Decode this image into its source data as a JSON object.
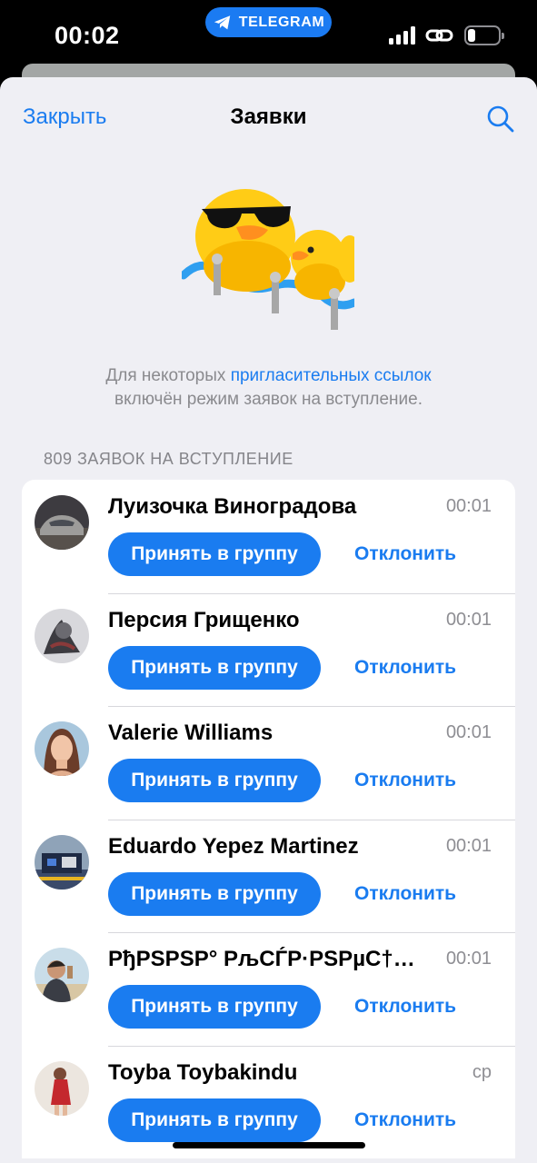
{
  "status_bar": {
    "time": "00:02",
    "pill_label": "TELEGRAM"
  },
  "nav": {
    "close_label": "Закрыть",
    "title": "Заявки"
  },
  "info": {
    "prefix": "Для некоторых ",
    "link": "пригласительных ссылок",
    "suffix": "включён режим заявок на вступление."
  },
  "section_header": "809 ЗАЯВОК НА ВСТУПЛЕНИЕ",
  "requests": [
    {
      "name": "Луизочка Виноградова",
      "time": "00:01",
      "accept_label": "Принять в группу",
      "decline_label": "Отклонить"
    },
    {
      "name": "Персия Грищенко",
      "time": "00:01",
      "accept_label": "Принять в группу",
      "decline_label": "Отклонить"
    },
    {
      "name": "Valerie Williams",
      "time": "00:01",
      "accept_label": "Принять в группу",
      "decline_label": "Отклонить"
    },
    {
      "name": "Eduardo Yepez Martinez",
      "time": "00:01",
      "accept_label": "Принять в группу",
      "decline_label": "Отклонить"
    },
    {
      "name": "РђРЅРЅР° РљСЃР·РЅРµС†…",
      "time": "00:01",
      "accept_label": "Принять в группу",
      "decline_label": "Отклонить"
    },
    {
      "name": "Toyba Toybakindu",
      "time": "ср",
      "accept_label": "Принять в группу",
      "decline_label": "Отклонить"
    }
  ],
  "colors": {
    "accent": "#1a7cf0",
    "sheet_background": "#efeff4",
    "secondary_text": "#8e8e93"
  }
}
